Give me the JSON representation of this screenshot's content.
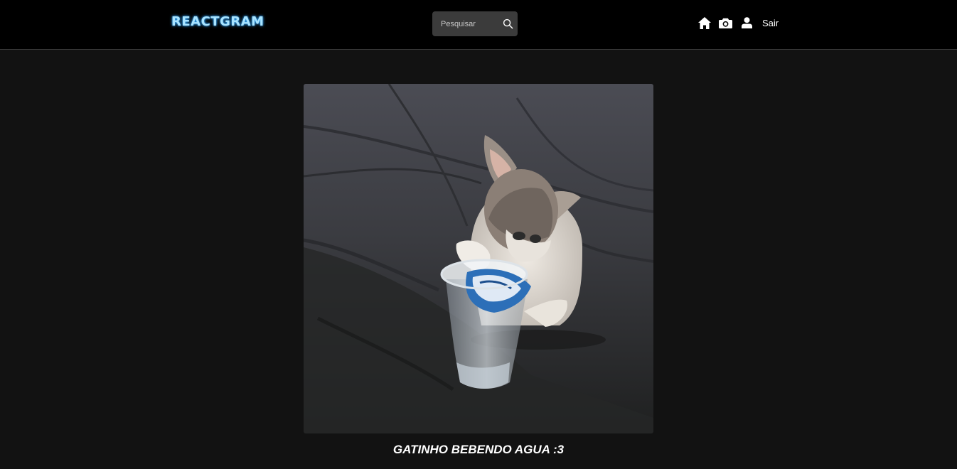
{
  "navbar": {
    "logo": "REACTGRAM",
    "search": {
      "placeholder": "Pesquisar",
      "value": ""
    },
    "icons": [
      "home-icon",
      "camera-icon",
      "user-icon"
    ],
    "logout_label": "Sair"
  },
  "photo": {
    "title": "GATINHO BEBENDO AGUA :3"
  },
  "colors": {
    "background": "#121212",
    "navbar": "#000000",
    "logo": "#a9e4ff",
    "search_bg": "#3b3b3b"
  }
}
